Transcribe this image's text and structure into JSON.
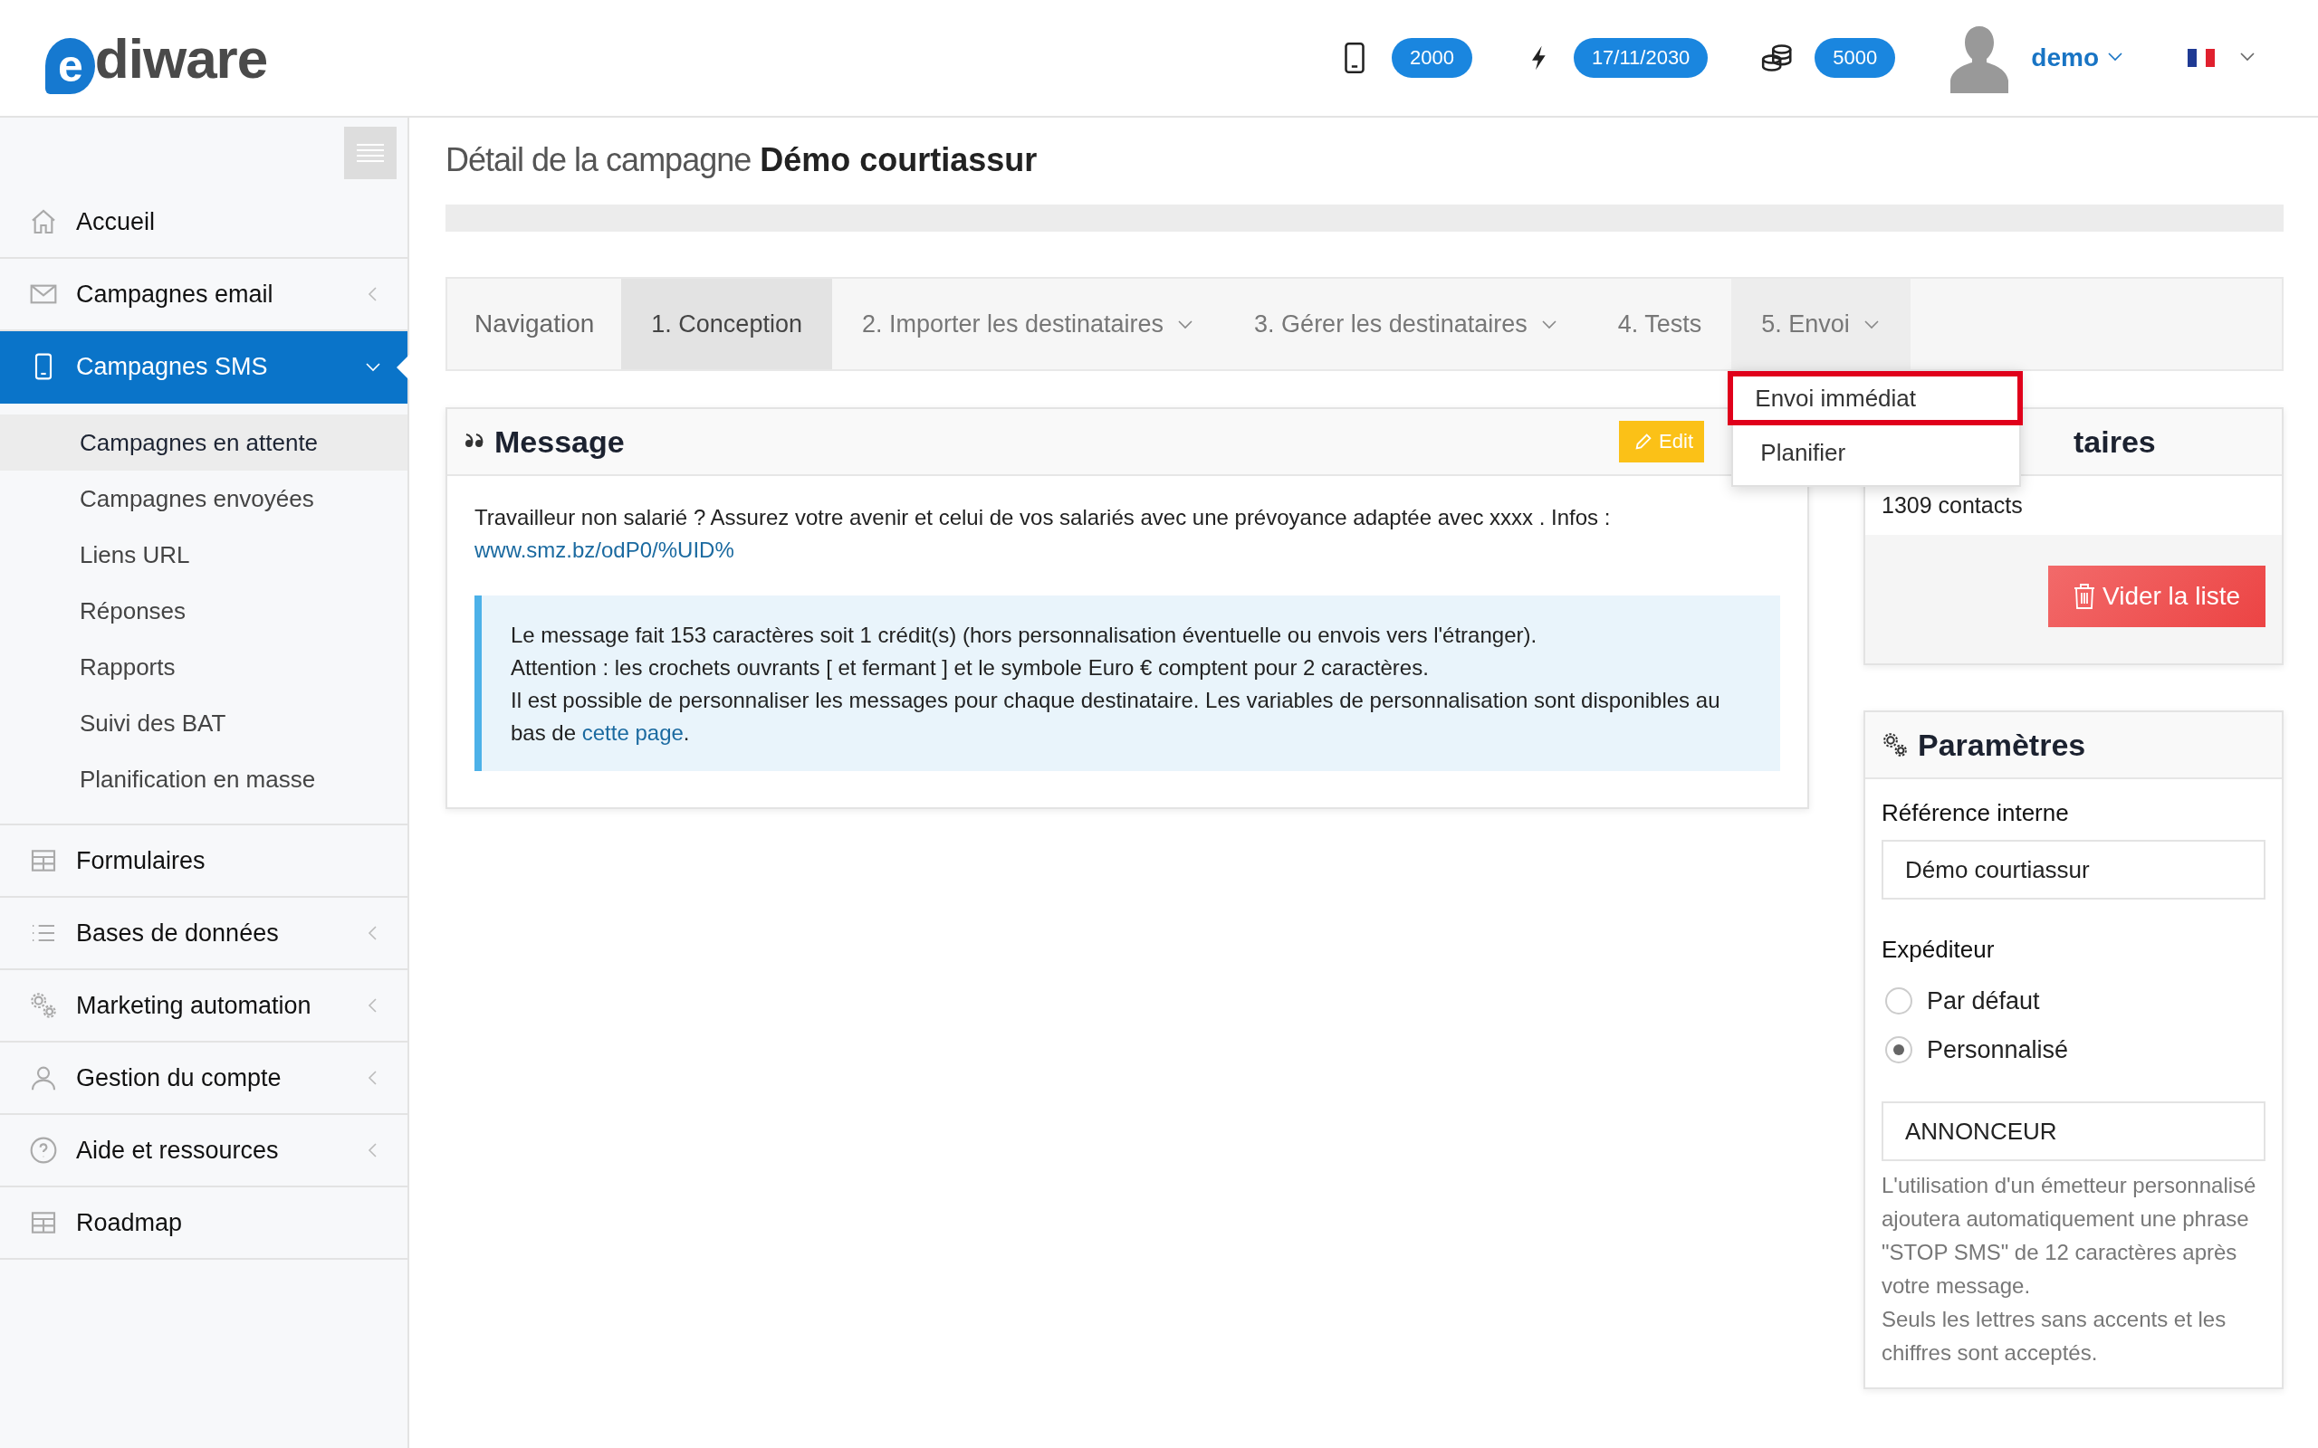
{
  "header": {
    "logo": "ediware",
    "badges": [
      {
        "kind": "phone",
        "value": "2000"
      },
      {
        "kind": "bolt",
        "value": "17/11/2030"
      },
      {
        "kind": "coins",
        "value": "5000"
      }
    ],
    "user": "demo"
  },
  "sidebar": {
    "items": [
      {
        "label": "Accueil",
        "kind": "home",
        "submenu": false,
        "selected": false
      },
      {
        "label": "Campagnes email",
        "kind": "mail",
        "submenu": true,
        "expanded": false,
        "selected": false
      },
      {
        "label": "Campagnes SMS",
        "kind": "phone",
        "submenu": true,
        "expanded": true,
        "selected": true,
        "children": [
          {
            "label": "Campagnes en attente",
            "selected": true
          },
          {
            "label": "Campagnes envoyées",
            "selected": false
          },
          {
            "label": "Liens URL",
            "selected": false
          },
          {
            "label": "Réponses",
            "selected": false
          },
          {
            "label": "Rapports",
            "selected": false
          },
          {
            "label": "Suivi des BAT",
            "selected": false
          },
          {
            "label": "Planification en masse",
            "selected": false
          }
        ]
      },
      {
        "label": "Formulaires",
        "kind": "table",
        "submenu": false,
        "selected": false
      },
      {
        "label": "Bases de données",
        "kind": "list",
        "submenu": true,
        "expanded": false,
        "selected": false
      },
      {
        "label": "Marketing automation",
        "kind": "gears",
        "submenu": true,
        "expanded": false,
        "selected": false
      },
      {
        "label": "Gestion du compte",
        "kind": "user",
        "submenu": true,
        "expanded": false,
        "selected": false
      },
      {
        "label": "Aide et ressources",
        "kind": "help",
        "submenu": true,
        "expanded": false,
        "selected": false
      },
      {
        "label": "Roadmap",
        "kind": "table",
        "submenu": false,
        "selected": false
      }
    ]
  },
  "page": {
    "title_prefix": "Détail de la campagne",
    "campaign_name": "Démo courtiassur"
  },
  "tabs": {
    "nav_label": "Navigation",
    "items": [
      {
        "label": "1. Conception",
        "selected": true,
        "dropdown": false
      },
      {
        "label": "2. Importer les destinataires",
        "selected": false,
        "dropdown": true,
        "open": false
      },
      {
        "label": "3. Gérer les destinataires",
        "selected": false,
        "dropdown": true,
        "open": false
      },
      {
        "label": "4. Tests",
        "selected": false,
        "dropdown": false
      },
      {
        "label": "5. Envoi",
        "selected": false,
        "dropdown": true,
        "open": true,
        "menu": [
          {
            "label": "Envoi immédiat",
            "highlighted": true
          },
          {
            "label": "Planifier",
            "highlighted": false
          }
        ]
      }
    ]
  },
  "message": {
    "title": "Message",
    "edit_button": "Edit",
    "text": "Travailleur non salarié ? Assurez votre avenir et celui de vos salariés avec une prévoyance adaptée avec xxxx . Infos :",
    "link": "www.smz.bz/odP0/%UID%",
    "info_lines": [
      "Le message fait 153 caractères soit 1 crédit(s) (hors personnalisation éventuelle ou envois vers l'étranger).",
      "Attention : les crochets ouvrants [ et fermant ] et le symbole Euro € comptent pour 2 caractères."
    ],
    "info_last": {
      "before": "Il est possible de personnaliser les messages pour chaque destinataire. Les variables de personnalisation sont disponibles au bas de",
      "link": "cette page",
      "after": "."
    }
  },
  "recipients": {
    "title": "taires",
    "count": "1309 contacts",
    "clear_button": "Vider la liste"
  },
  "settings": {
    "title": "Paramètres",
    "reference_label": "Référence interne",
    "reference_value": "Démo courtiassur",
    "sender_label": "Expéditeur",
    "sender_options": [
      {
        "label": "Par défaut",
        "selected": false
      },
      {
        "label": "Personnalisé",
        "selected": true
      }
    ],
    "sender_value": "ANNONCEUR",
    "help": [
      "L'utilisation d'un émetteur personnalisé ajoutera automatiquement une phrase \"STOP SMS\" de 12 caractères après votre message.",
      "Seuls les lettres sans accents et les chiffres sont acceptés."
    ]
  }
}
